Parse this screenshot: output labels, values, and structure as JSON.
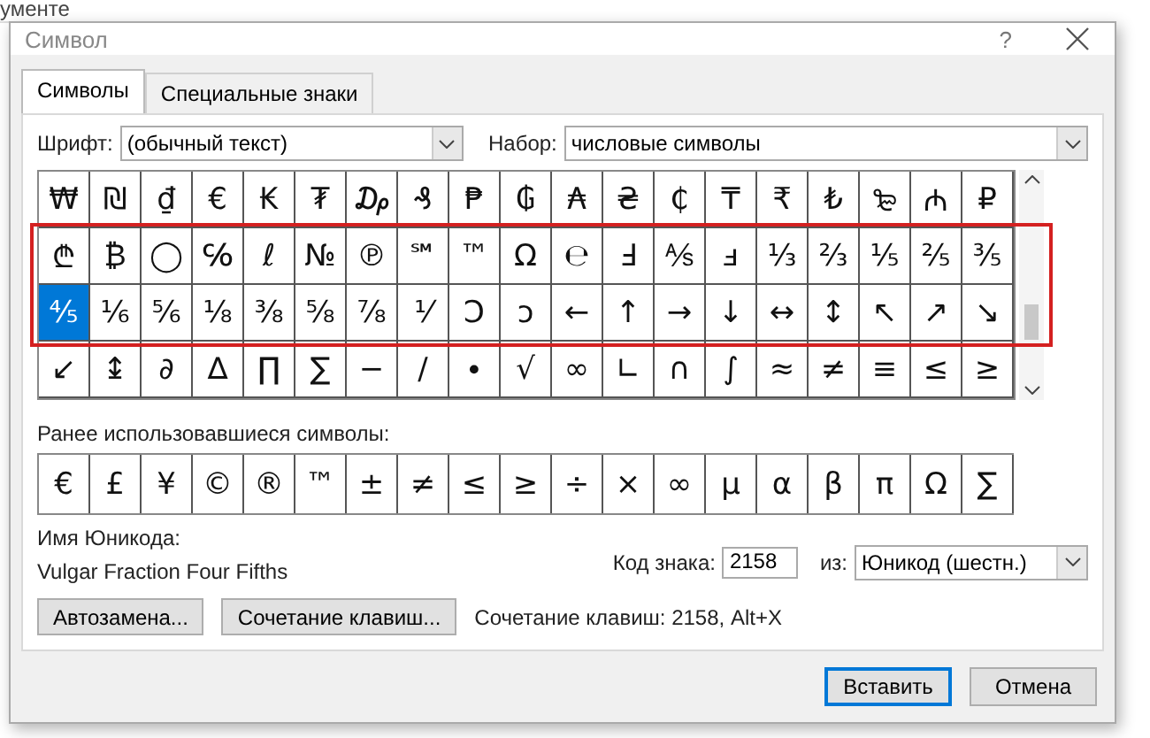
{
  "background": {
    "doc_text": "ументе"
  },
  "window": {
    "title": "Символ",
    "help": "?"
  },
  "tabs": [
    {
      "label": "Символы",
      "selected": true
    },
    {
      "label": "Специальные знаки",
      "selected": false
    }
  ],
  "font_field": {
    "label": "Шрифт:",
    "value": "(обычный текст)"
  },
  "subset_field": {
    "label": "Набор:",
    "value": "числовые символы"
  },
  "symbol_rows": [
    {
      "highlighted": false,
      "cells": [
        {
          "char": "₩",
          "selected": false
        },
        {
          "char": "₪",
          "selected": false
        },
        {
          "char": "₫",
          "selected": false
        },
        {
          "char": "€",
          "selected": false
        },
        {
          "char": "₭",
          "selected": false
        },
        {
          "char": "₮",
          "selected": false
        },
        {
          "char": "₯",
          "selected": false
        },
        {
          "char": "₰",
          "selected": false
        },
        {
          "char": "₱",
          "selected": false
        },
        {
          "char": "₲",
          "selected": false
        },
        {
          "char": "₳",
          "selected": false
        },
        {
          "char": "₴",
          "selected": false
        },
        {
          "char": "₵",
          "selected": false
        },
        {
          "char": "₸",
          "selected": false
        },
        {
          "char": "₹",
          "selected": false
        },
        {
          "char": "₺",
          "selected": false
        },
        {
          "char": "₻",
          "selected": false
        },
        {
          "char": "₼",
          "selected": false
        },
        {
          "char": "₽",
          "selected": false
        }
      ]
    },
    {
      "highlighted": true,
      "cells": [
        {
          "char": "₾",
          "selected": false
        },
        {
          "char": "₿",
          "selected": false
        },
        {
          "char": "◯",
          "selected": false
        },
        {
          "char": "℅",
          "selected": false
        },
        {
          "char": "ℓ",
          "selected": false
        },
        {
          "char": "№",
          "selected": false
        },
        {
          "char": "℗",
          "selected": false
        },
        {
          "char": "℠",
          "selected": false
        },
        {
          "char": "™",
          "selected": false
        },
        {
          "char": "Ω",
          "selected": false
        },
        {
          "char": "℮",
          "selected": false
        },
        {
          "char": "Ⅎ",
          "selected": false
        },
        {
          "char": "⅍",
          "selected": false
        },
        {
          "char": "ⅎ",
          "selected": false
        },
        {
          "char": "⅓",
          "selected": false
        },
        {
          "char": "⅔",
          "selected": false
        },
        {
          "char": "⅕",
          "selected": false
        },
        {
          "char": "⅖",
          "selected": false
        },
        {
          "char": "⅗",
          "selected": false
        }
      ]
    },
    {
      "highlighted": true,
      "cells": [
        {
          "char": "⅘",
          "selected": true
        },
        {
          "char": "⅙",
          "selected": false
        },
        {
          "char": "⅚",
          "selected": false
        },
        {
          "char": "⅛",
          "selected": false
        },
        {
          "char": "⅜",
          "selected": false
        },
        {
          "char": "⅝",
          "selected": false
        },
        {
          "char": "⅞",
          "selected": false
        },
        {
          "char": "⅟",
          "selected": false
        },
        {
          "char": "Ↄ",
          "selected": false
        },
        {
          "char": "ↄ",
          "selected": false
        },
        {
          "char": "←",
          "selected": false
        },
        {
          "char": "↑",
          "selected": false
        },
        {
          "char": "→",
          "selected": false
        },
        {
          "char": "↓",
          "selected": false
        },
        {
          "char": "↔",
          "selected": false
        },
        {
          "char": "↕",
          "selected": false
        },
        {
          "char": "↖",
          "selected": false
        },
        {
          "char": "↗",
          "selected": false
        },
        {
          "char": "↘",
          "selected": false
        }
      ]
    },
    {
      "highlighted": false,
      "cells": [
        {
          "char": "↙",
          "selected": false
        },
        {
          "char": "↨",
          "selected": false
        },
        {
          "char": "∂",
          "selected": false
        },
        {
          "char": "∆",
          "selected": false
        },
        {
          "char": "∏",
          "selected": false
        },
        {
          "char": "∑",
          "selected": false
        },
        {
          "char": "−",
          "selected": false
        },
        {
          "char": "∕",
          "selected": false
        },
        {
          "char": "∙",
          "selected": false
        },
        {
          "char": "√",
          "selected": false
        },
        {
          "char": "∞",
          "selected": false
        },
        {
          "char": "∟",
          "selected": false
        },
        {
          "char": "∩",
          "selected": false
        },
        {
          "char": "∫",
          "selected": false
        },
        {
          "char": "≈",
          "selected": false
        },
        {
          "char": "≠",
          "selected": false
        },
        {
          "char": "≡",
          "selected": false
        },
        {
          "char": "≤",
          "selected": false
        },
        {
          "char": "≥",
          "selected": false
        }
      ]
    }
  ],
  "recent_label": "Ранее использовавшиеся символы:",
  "recent_symbols": [
    "€",
    "£",
    "¥",
    "©",
    "®",
    "™",
    "±",
    "≠",
    "≤",
    "≥",
    "÷",
    "×",
    "∞",
    "µ",
    "α",
    "β",
    "π",
    "Ω",
    "∑"
  ],
  "unicode_name_label": "Имя Юникода:",
  "unicode_name": "Vulgar Fraction Four Fifths",
  "char_code": {
    "label": "Код знака:",
    "value": "2158"
  },
  "from_field": {
    "label": "из:",
    "value": "Юникод (шестн.)"
  },
  "tool_buttons": [
    "Автозамена...",
    "Сочетание клавиш..."
  ],
  "shortcut_text": "Сочетание клавиш: 2158, Alt+X",
  "footer_buttons": [
    {
      "label": "Вставить",
      "default": true
    },
    {
      "label": "Отмена",
      "default": false
    }
  ]
}
